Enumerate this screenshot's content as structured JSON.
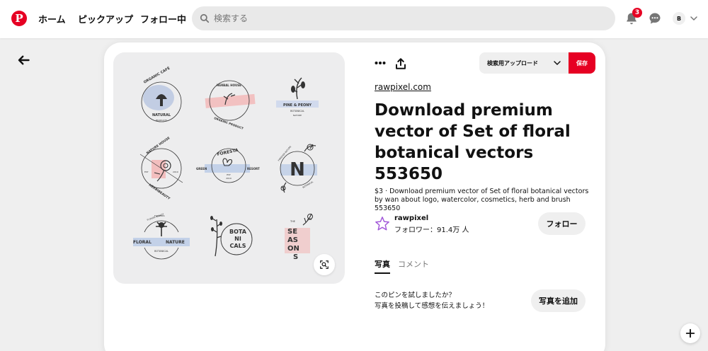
{
  "header": {
    "nav": [
      {
        "label": "ホーム"
      },
      {
        "label": "ピックアップ"
      },
      {
        "label": "フォロー中"
      }
    ],
    "search_placeholder": "検索する",
    "notification_count": "3",
    "user_initial": "B",
    "icons": [
      "pinterest-logo-icon",
      "search-icon",
      "bell-icon",
      "chat-icon",
      "chevron-down-icon"
    ]
  },
  "pin": {
    "board_select_label": "検索用アップロード",
    "save_label": "保存",
    "source": "rawpixel.com",
    "title": "Download premium vector of Set of floral botanical vectors 553650",
    "description": "$3 · Download premium vector of Set of floral botanical vectors by wan about logo, watercolor, cosmetics, herb and brush 553650",
    "image_logos": {
      "l1": [
        "ORGANIC CAFÉ",
        "NATURAL",
        "PRODUCTS"
      ],
      "l2": [
        "HERBAL HOUSE",
        "ORGANIC PRODUCT"
      ],
      "l3": [
        "PINE & PEONY",
        "BOTANICAL",
        "NATURE"
      ],
      "l4": [
        "NATURE HOUSE",
        "HERBIBEAUTY",
        "EST",
        "2019"
      ],
      "l5": [
        "FORESTA",
        "GREEN",
        "RESORT",
        "EST",
        "2019"
      ],
      "l6": [
        "N",
        "FOREVER NATURE",
        "BOTANICAL"
      ],
      "l7": [
        "FLORAL",
        "NATURE",
        "BOTANICAL",
        "FLOWER BEAUTY",
        "FLOWERS"
      ],
      "l8": [
        "BOTA",
        "NI",
        "CALS"
      ],
      "l9": [
        "THE",
        "SE",
        "AS",
        "ON",
        "S"
      ]
    }
  },
  "creator": {
    "name": "rawpixel",
    "followers": "フォロワー：91.4万 人",
    "follow_label": "フォロー"
  },
  "tabs": [
    {
      "label": "写真",
      "active": true
    },
    {
      "label": "コメント",
      "active": false
    }
  ],
  "tried": {
    "line1": "このピンを試しましたか？",
    "line2": "写真を投稿して感想を伝えましょう！",
    "button_label": "写真を追加"
  },
  "colors": {
    "brand_red": "#e60023",
    "surface": "#efefef",
    "text": "#111111"
  }
}
